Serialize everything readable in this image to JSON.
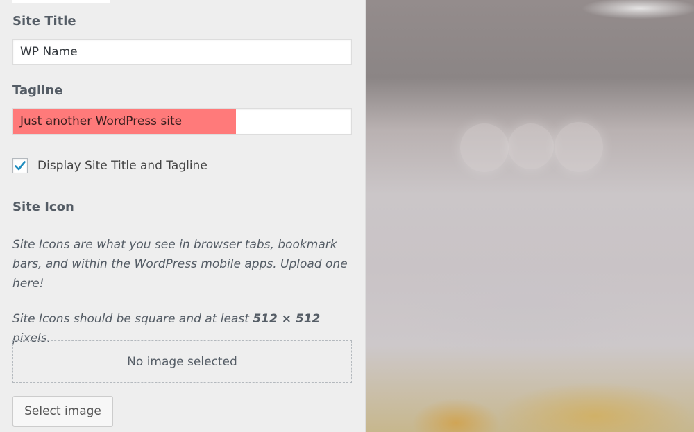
{
  "site_title": {
    "label": "Site Title",
    "value": "WP Name"
  },
  "tagline": {
    "label": "Tagline",
    "value": "Just another WordPress site"
  },
  "display_option": {
    "checked": true,
    "label": "Display Site Title and Tagline"
  },
  "site_icon": {
    "label": "Site Icon",
    "description": "Site Icons are what you see in browser tabs, bookmark bars, and within the WordPress mobile apps. Upload one here!",
    "size_note_prefix": "Site Icons should be square and at least ",
    "size_note_dimensions": "512 × 512",
    "size_note_suffix": " pixels.",
    "placeholder": "No image selected",
    "select_button": "Select image"
  },
  "colors": {
    "highlight": "#ff7a7a",
    "checkmark": "#1e8cbe",
    "panel_bg": "#eeeeee"
  },
  "icons": {
    "checkbox_mark": "checkmark-icon"
  }
}
